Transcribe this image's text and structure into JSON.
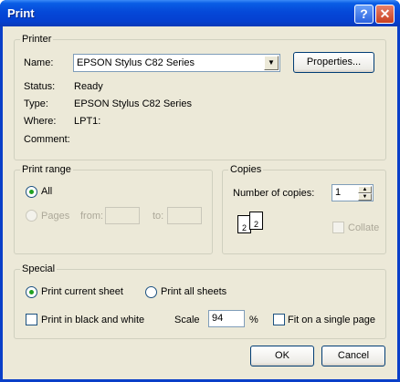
{
  "window": {
    "title": "Print",
    "help_label": "?",
    "close_label": "✕"
  },
  "printer": {
    "group_label": "Printer",
    "name_label": "Name:",
    "name_value": "EPSON Stylus C82 Series",
    "properties_label": "Properties...",
    "status_label": "Status:",
    "status_value": "Ready",
    "type_label": "Type:",
    "type_value": "EPSON Stylus C82 Series",
    "where_label": "Where:",
    "where_value": "LPT1:",
    "comment_label": "Comment:"
  },
  "print_range": {
    "group_label": "Print range",
    "all_label": "All",
    "pages_label": "Pages",
    "from_label": "from:",
    "to_label": "to:",
    "selected": "All"
  },
  "copies": {
    "group_label": "Copies",
    "number_label": "Number of copies:",
    "number_value": "1",
    "collate_label": "Collate",
    "collate_checked": false,
    "page_labels": [
      "2",
      "2"
    ]
  },
  "special": {
    "group_label": "Special",
    "current_sheet_label": "Print current sheet",
    "all_sheets_label": "Print all sheets",
    "selected": "Print current sheet",
    "bw_label": "Print in black and white",
    "bw_checked": false,
    "scale_label": "Scale",
    "scale_value": "94",
    "percent_label": "%",
    "fit_label": "Fit on a single page",
    "fit_checked": false
  },
  "buttons": {
    "ok_label": "OK",
    "cancel_label": "Cancel"
  },
  "icons": {
    "dropdown": "chevron-down-icon",
    "spin_up": "spin-up-icon",
    "spin_down": "spin-down-icon"
  }
}
